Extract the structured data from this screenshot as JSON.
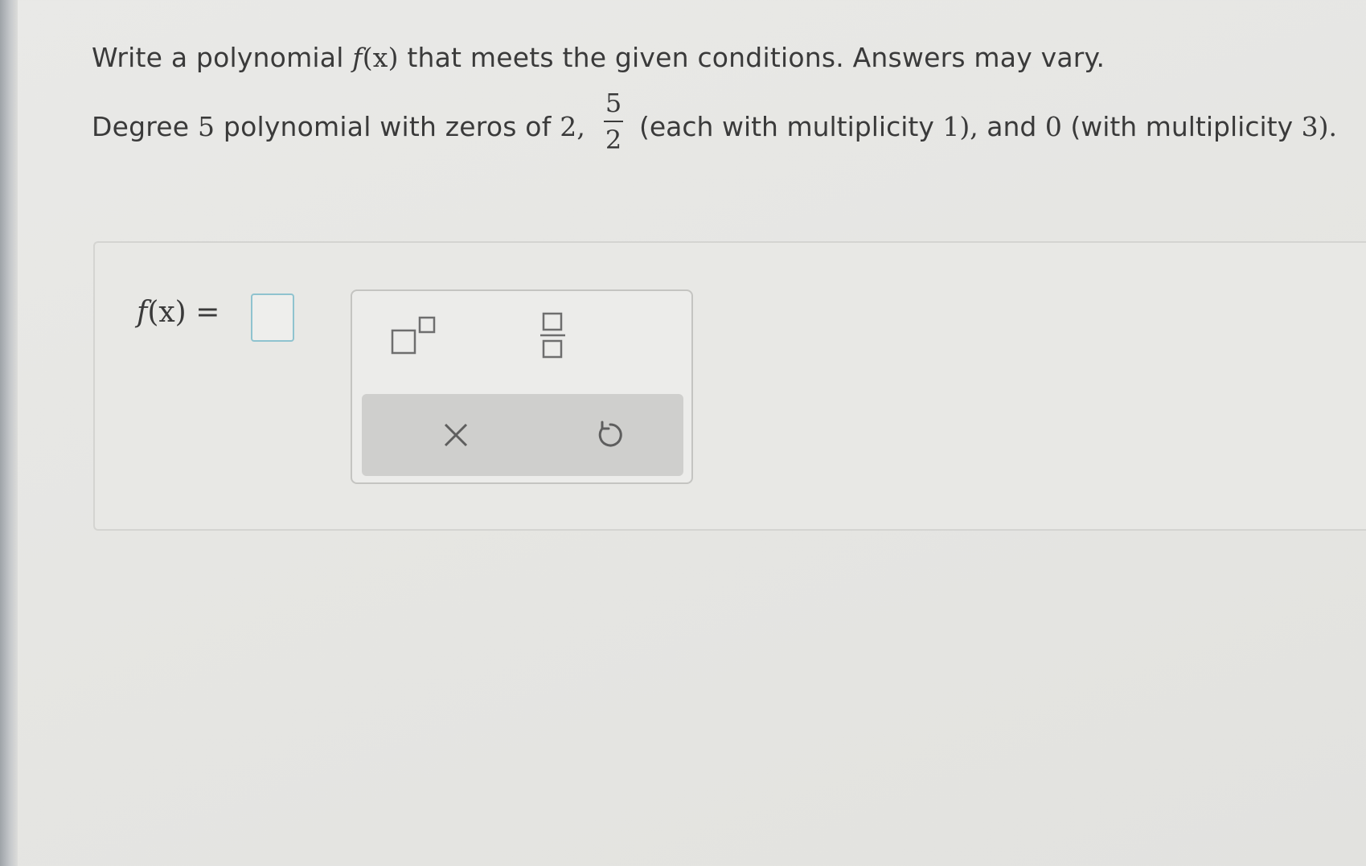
{
  "question": {
    "line1_prefix": "Write a polynomial",
    "line1_fname": "f",
    "line1_fargs": "(x)",
    "line1_suffix": "that meets the given conditions. Answers may vary.",
    "line2_degree_prefix": "Degree",
    "line2_degree_value": "5",
    "line2_zeros_text": "polynomial with zeros of",
    "line2_zero_value": "2,",
    "fraction_numerator": "5",
    "fraction_denominator": "2",
    "line2_mult_text": "(each with multiplicity",
    "line2_mult_value": "1),",
    "line2_and": "and",
    "line2_zero2_value": "0",
    "line2_mult2_text": "(with multiplicity",
    "line2_mult2_value": "3)."
  },
  "answer": {
    "label_f": "f",
    "label_args": "(x)",
    "label_equals": "=",
    "input_value": ""
  },
  "palette": {
    "buttons": [
      {
        "name": "exponent-template",
        "icon": "superscript-box-icon"
      },
      {
        "name": "fraction-template",
        "icon": "fraction-box-icon"
      },
      {
        "name": "clear",
        "icon": "close-icon"
      },
      {
        "name": "undo",
        "icon": "undo-icon"
      }
    ],
    "icon_color": "#6e6e6e"
  }
}
